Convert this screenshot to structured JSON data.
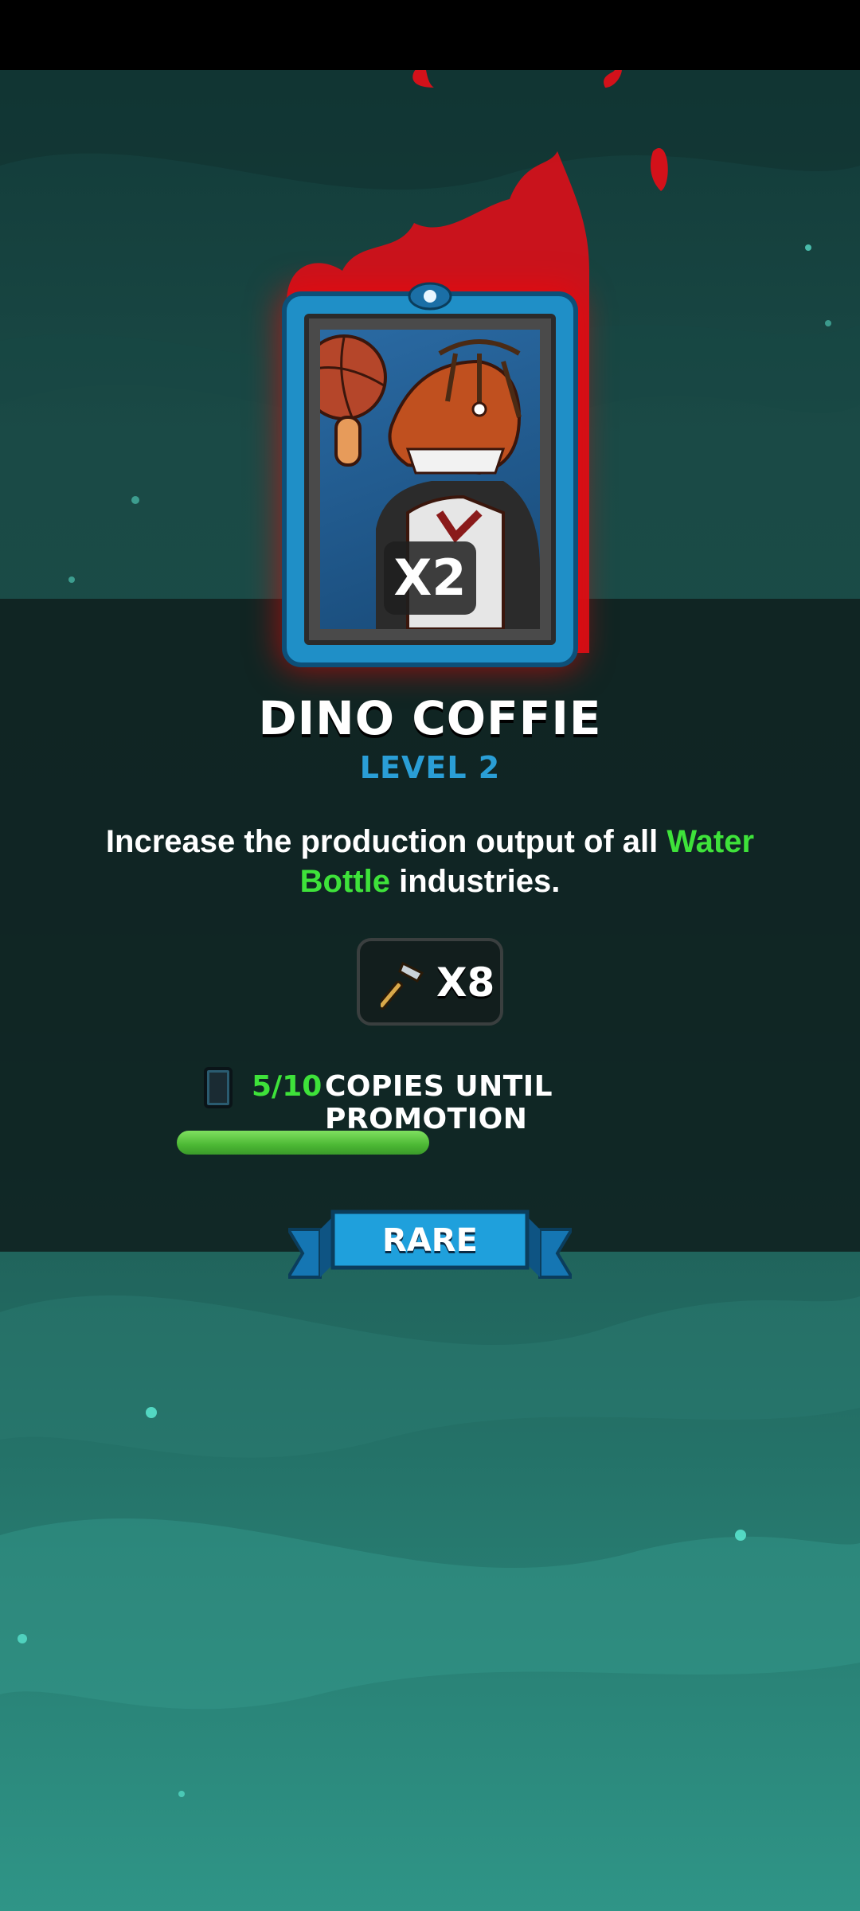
{
  "card": {
    "name": "DINO COFFIE",
    "level": "LEVEL 2",
    "multiplier": "X2",
    "rarity": "RARE"
  },
  "description": {
    "prefix": "Increase the production output of all ",
    "highlight": "Water Bottle",
    "suffix": " industries."
  },
  "reward": {
    "icon": "hammer-icon",
    "count": "X8"
  },
  "promotion": {
    "copies": "5/10",
    "label": "COPIES UNTIL PROMOTION",
    "progress_fraction": 0.5
  },
  "colors": {
    "accent_green": "#3ee23a",
    "level_blue": "#2a9ed6",
    "card_glow": "#ff1a1a"
  }
}
